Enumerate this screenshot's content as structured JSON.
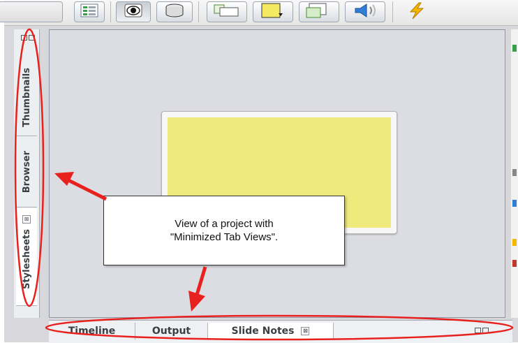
{
  "toolbar": {
    "buttons": [
      {
        "icon": "properties-panel-icon"
      },
      {
        "icon": "preview-eye-icon",
        "active": true
      },
      {
        "icon": "record-cylinder-icon"
      },
      {
        "icon": "text-caption-icon"
      },
      {
        "icon": "highlight-box-icon"
      },
      {
        "icon": "image-slide-icon"
      },
      {
        "icon": "audio-speaker-icon"
      },
      {
        "icon": "lightning-icon"
      }
    ]
  },
  "left_panel": {
    "tabs": [
      {
        "label": "Thumbnails"
      },
      {
        "label": "Browser"
      },
      {
        "label": "Stylesheets",
        "close": "⊠"
      }
    ]
  },
  "bottom_panel": {
    "tabs": [
      {
        "label": "Timeline"
      },
      {
        "label": "Output"
      },
      {
        "label": "Slide Notes",
        "close": "⊠"
      }
    ]
  },
  "callout": {
    "line1": "View of a project with",
    "line2": "\"Minimized Tab Views\"."
  },
  "colors": {
    "slide": "#f0e97c",
    "annotation_red": "#e8211f",
    "canvas_bg": "#dcdde3"
  }
}
